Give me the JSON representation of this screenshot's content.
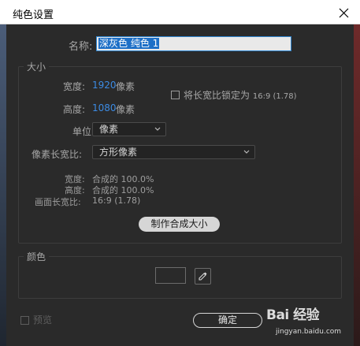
{
  "window": {
    "title": "纯色设置"
  },
  "name": {
    "label": "名称:",
    "value": "深灰色 纯色 1"
  },
  "size": {
    "group_title": "大小",
    "width_label": "宽度:",
    "width_value": "1920",
    "width_unit": "像素",
    "height_label": "高度:",
    "height_value": "1080",
    "height_unit": "像素",
    "lock_label": "将长宽比锁定为",
    "lock_ratio": "16:9 (1.78)",
    "units_label": "单位:",
    "units_value": "像素",
    "pixel_aspect_label": "像素长宽比:",
    "pixel_aspect_value": "方形像素",
    "info_width_label": "宽度:",
    "info_width_value": "合成的 100.0%",
    "info_height_label": "高度:",
    "info_height_value": "合成的 100.0%",
    "info_frame_label": "画面长宽比:",
    "info_frame_value": "16:9 (1.78)",
    "make_comp_size_button": "制作合成大小"
  },
  "color": {
    "group_title": "颜色",
    "swatch_color": "#2a2a2a"
  },
  "footer": {
    "preview_label": "预览",
    "ok_button": "确定"
  },
  "watermark": {
    "brand_text": "Bai 经验",
    "url": "jingyan.baidu.com"
  },
  "colors": {
    "accent_value": "#3c8be3",
    "selection": "#1d6fc7",
    "background": "#2a2a2a"
  }
}
